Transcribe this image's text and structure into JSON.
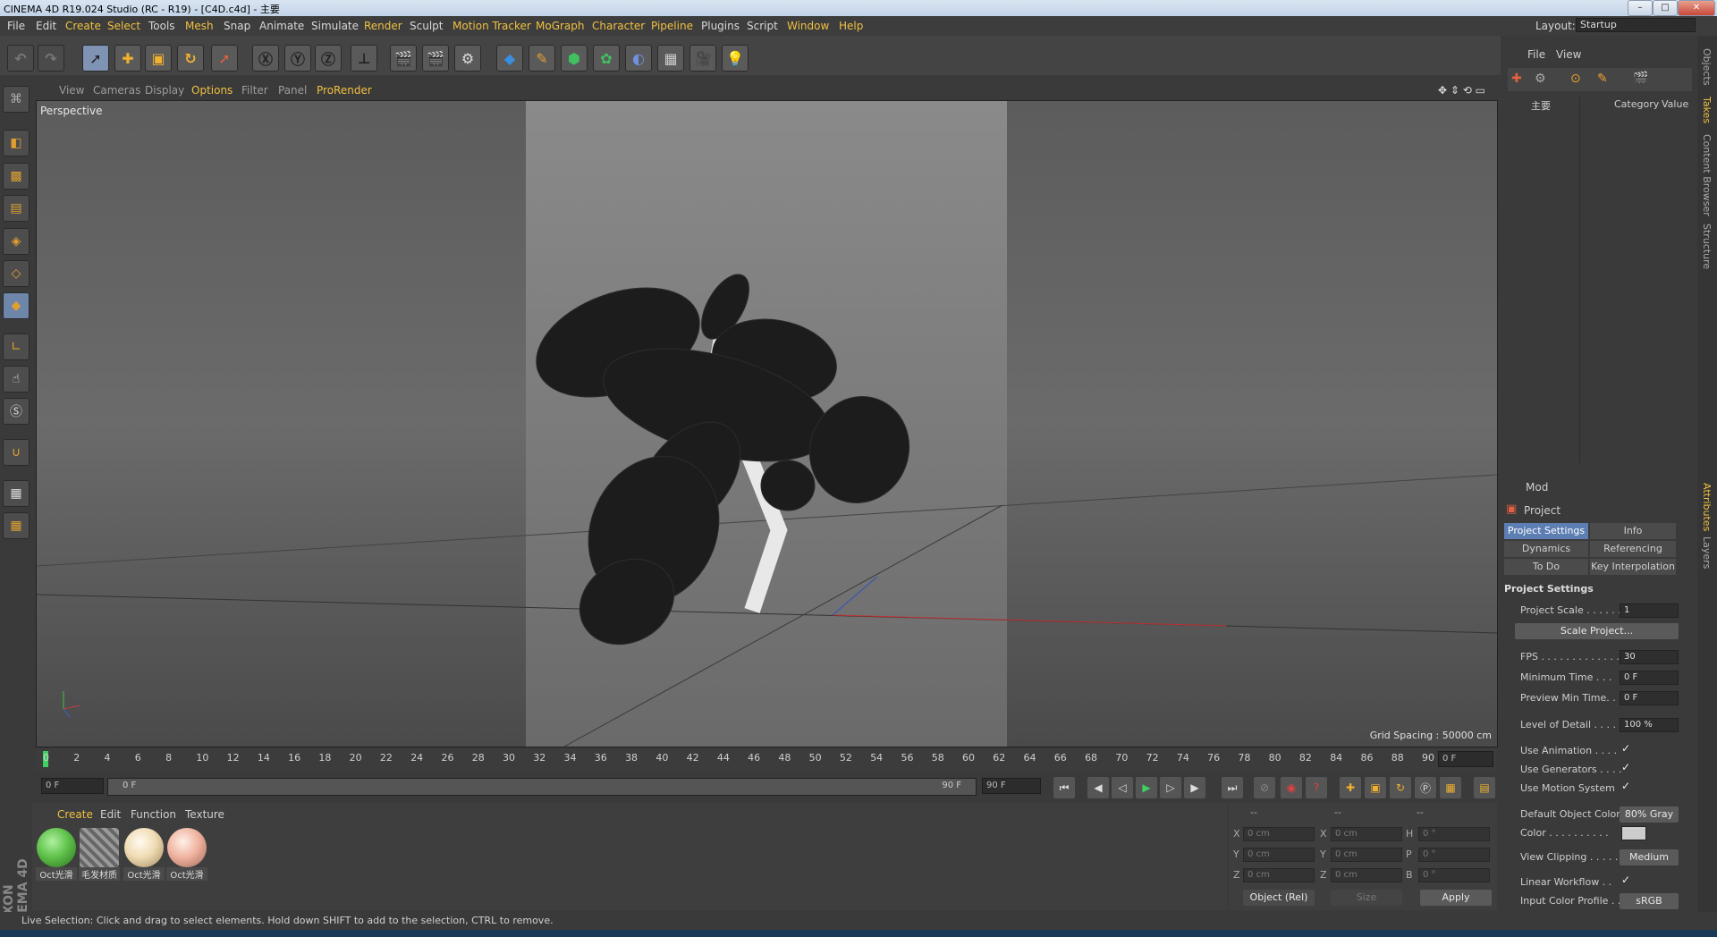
{
  "titlebar": {
    "title": "CINEMA 4D R19.024 Studio (RC - R19) - [C4D.c4d] - 主要"
  },
  "menubar": {
    "items": [
      "File",
      "Edit",
      "Create",
      "Select",
      "Tools",
      "Mesh",
      "Snap",
      "Animate",
      "Simulate",
      "Render",
      "Sculpt",
      "Motion Tracker",
      "MoGraph",
      "Character",
      "Pipeline",
      "Plugins",
      "Script",
      "Window",
      "Help"
    ],
    "layout_label": "Layout:",
    "layout_value": "Startup"
  },
  "viewport": {
    "menu": [
      "View",
      "Cameras",
      "Display",
      "Options",
      "Filter",
      "Panel",
      "ProRender"
    ],
    "camera": "Perspective",
    "grid_spacing": "Grid Spacing : 50000 cm"
  },
  "timeline": {
    "ticks": [
      "0",
      "2",
      "4",
      "6",
      "8",
      "10",
      "12",
      "14",
      "16",
      "18",
      "20",
      "22",
      "24",
      "26",
      "28",
      "30",
      "32",
      "34",
      "36",
      "38",
      "40",
      "42",
      "44",
      "46",
      "48",
      "50",
      "52",
      "54",
      "56",
      "58",
      "60",
      "62",
      "64",
      "66",
      "68",
      "70",
      "72",
      "74",
      "76",
      "78",
      "80",
      "82",
      "84",
      "86",
      "88",
      "90"
    ],
    "current_frame": "0 F",
    "start_field": "0 F",
    "range_start": "0 F",
    "range_end": "90 F",
    "end_field": "90 F"
  },
  "material_manager": {
    "menu": [
      "Create",
      "Edit",
      "Function",
      "Texture"
    ],
    "materials": [
      {
        "name": "Oct光滑",
        "color": "#5fc24a"
      },
      {
        "name": "毛发材质",
        "color": "#8c8c8c"
      },
      {
        "name": "Oct光滑",
        "color": "#f0dcb4"
      },
      {
        "name": "Oct光滑",
        "color": "#f0b4a0"
      }
    ]
  },
  "coordinates": {
    "headers": [
      "--",
      "--",
      "--"
    ],
    "rows": [
      [
        "X",
        "0 cm",
        "X",
        "0 cm",
        "H",
        "0 °"
      ],
      [
        "Y",
        "0 cm",
        "Y",
        "0 cm",
        "P",
        "0 °"
      ],
      [
        "Z",
        "0 cm",
        "Z",
        "0 cm",
        "B",
        "0 °"
      ]
    ],
    "mode": "Object (Rel)",
    "size_mode": "Size",
    "apply": "Apply"
  },
  "objects_panel": {
    "menu": [
      "File",
      "View"
    ],
    "columns": [
      "主要",
      "Category",
      "Value"
    ]
  },
  "attributes": {
    "menu": "Mod",
    "title": "Project",
    "tabs": [
      "Project Settings",
      "Info",
      "Dynamics",
      "Referencing",
      "To Do",
      "Key Interpolation"
    ],
    "section": "Project Settings",
    "fields": [
      {
        "label": "Project Scale . . . . . .",
        "value": "1"
      },
      {
        "label": "FPS . . . . . . . . . . . . . .",
        "value": "30"
      },
      {
        "label": "Minimum Time . . .",
        "value": "0 F"
      },
      {
        "label": "Preview Min Time. .",
        "value": "0 F"
      },
      {
        "label": "Level of Detail . . . . .",
        "value": "100 %"
      }
    ],
    "scale_button": "Scale Project...",
    "checks": [
      "Use Animation . . . .",
      "Use Generators . . . .",
      "Use Motion System"
    ],
    "check_mark": "✓",
    "default_color_label": "Default Object Color",
    "default_color_value": "80% Gray",
    "color_label": "Color . . . . . . . . . .",
    "view_clipping_label": "View Clipping . . . . .",
    "view_clipping_value": "Medium",
    "linear_workflow_label": "Linear Workflow . .",
    "input_color_label": "Input Color Profile . .",
    "input_color_value": "sRGB"
  },
  "side_tabs": [
    "Objects",
    "Takes",
    "Content Browser",
    "Structure",
    "Attributes",
    "Layers"
  ],
  "status": "Live Selection: Click and drag to select elements. Hold down SHIFT to add to the selection, CTRL to remove."
}
